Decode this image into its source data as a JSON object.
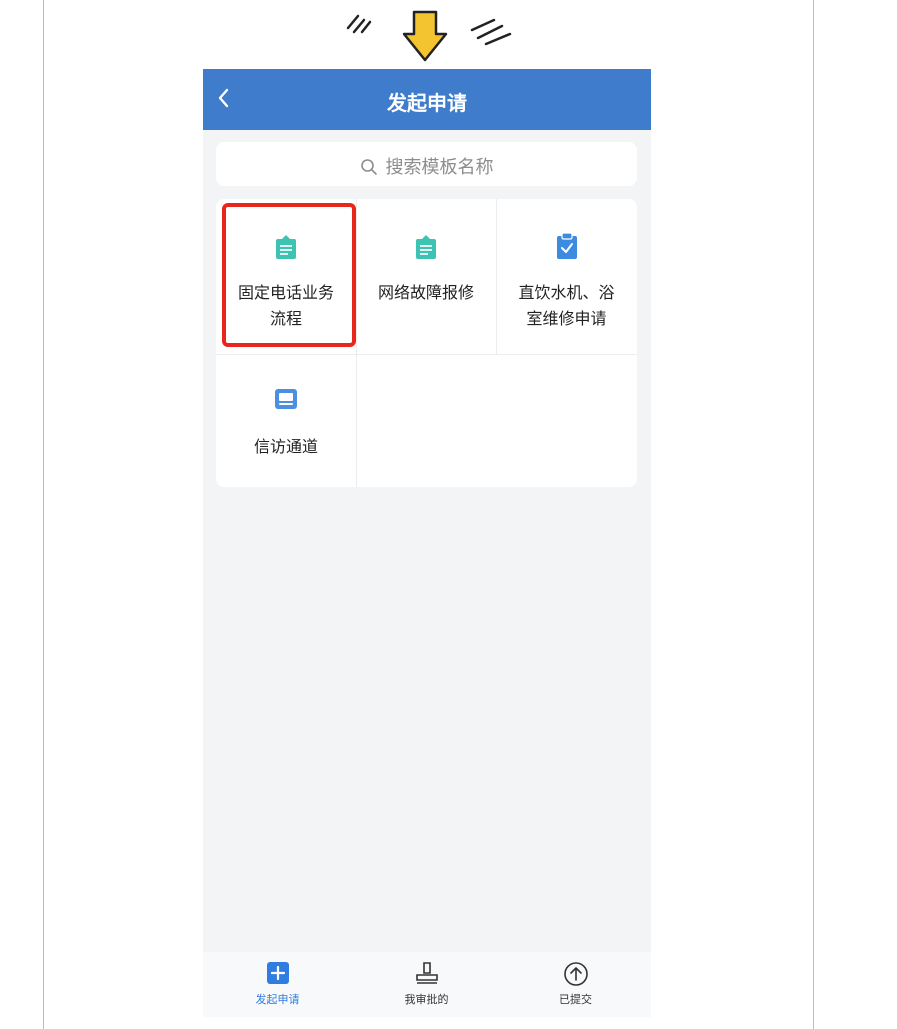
{
  "header": {
    "title": "发起申请",
    "back_icon": "chevron-left-icon"
  },
  "search": {
    "placeholder": "搜索模板名称",
    "icon": "search-icon"
  },
  "templates": [
    {
      "label_line1": "固定电话业务",
      "label_line2": "流程",
      "icon": "clipboard-doc-icon",
      "icon_color": "#3cc3b2",
      "highlighted": true
    },
    {
      "label_line1": "网络故障报修",
      "label_line2": "",
      "icon": "clipboard-doc-icon",
      "icon_color": "#3cc3b2"
    },
    {
      "label_line1": "直饮水机、浴",
      "label_line2": "室维修申请",
      "icon": "clipboard-check-icon",
      "icon_color": "#3d8be0"
    },
    {
      "label_line1": "信访通道",
      "label_line2": "",
      "icon": "inbox-tray-icon",
      "icon_color": "#4a8fe0"
    }
  ],
  "tabbar": {
    "tabs": [
      {
        "label": "发起申请",
        "icon": "add-square-icon",
        "active": true
      },
      {
        "label": "我审批的",
        "icon": "stamp-icon",
        "active": false
      },
      {
        "label": "已提交",
        "icon": "upload-circle-icon",
        "active": false
      }
    ]
  },
  "colors": {
    "header": "#3f7ccb",
    "highlight": "#e8261c",
    "active_tab": "#2f7de1"
  }
}
